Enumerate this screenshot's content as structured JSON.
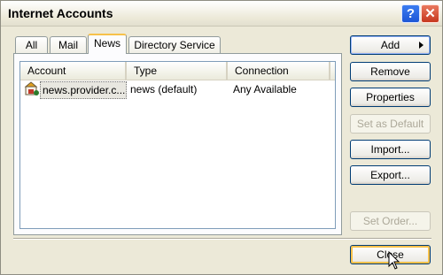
{
  "window": {
    "title": "Internet Accounts",
    "help_label": "?",
    "close_label": "✕"
  },
  "tabs": [
    {
      "label": "All"
    },
    {
      "label": "Mail"
    },
    {
      "label": "News"
    },
    {
      "label": "Directory Service"
    }
  ],
  "list": {
    "columns": [
      "Account",
      "Type",
      "Connection"
    ],
    "rows": [
      {
        "account": "news.provider.c...",
        "type": "news (default)",
        "connection": "Any Available"
      }
    ]
  },
  "buttons": {
    "add": "Add",
    "remove": "Remove",
    "properties": "Properties",
    "set_default": "Set as Default",
    "import": "Import...",
    "export": "Export...",
    "set_order": "Set Order...",
    "close": "Close"
  },
  "icons": {
    "account_icon": "news-server-icon",
    "cursor": "mouse-pointer-icon"
  }
}
